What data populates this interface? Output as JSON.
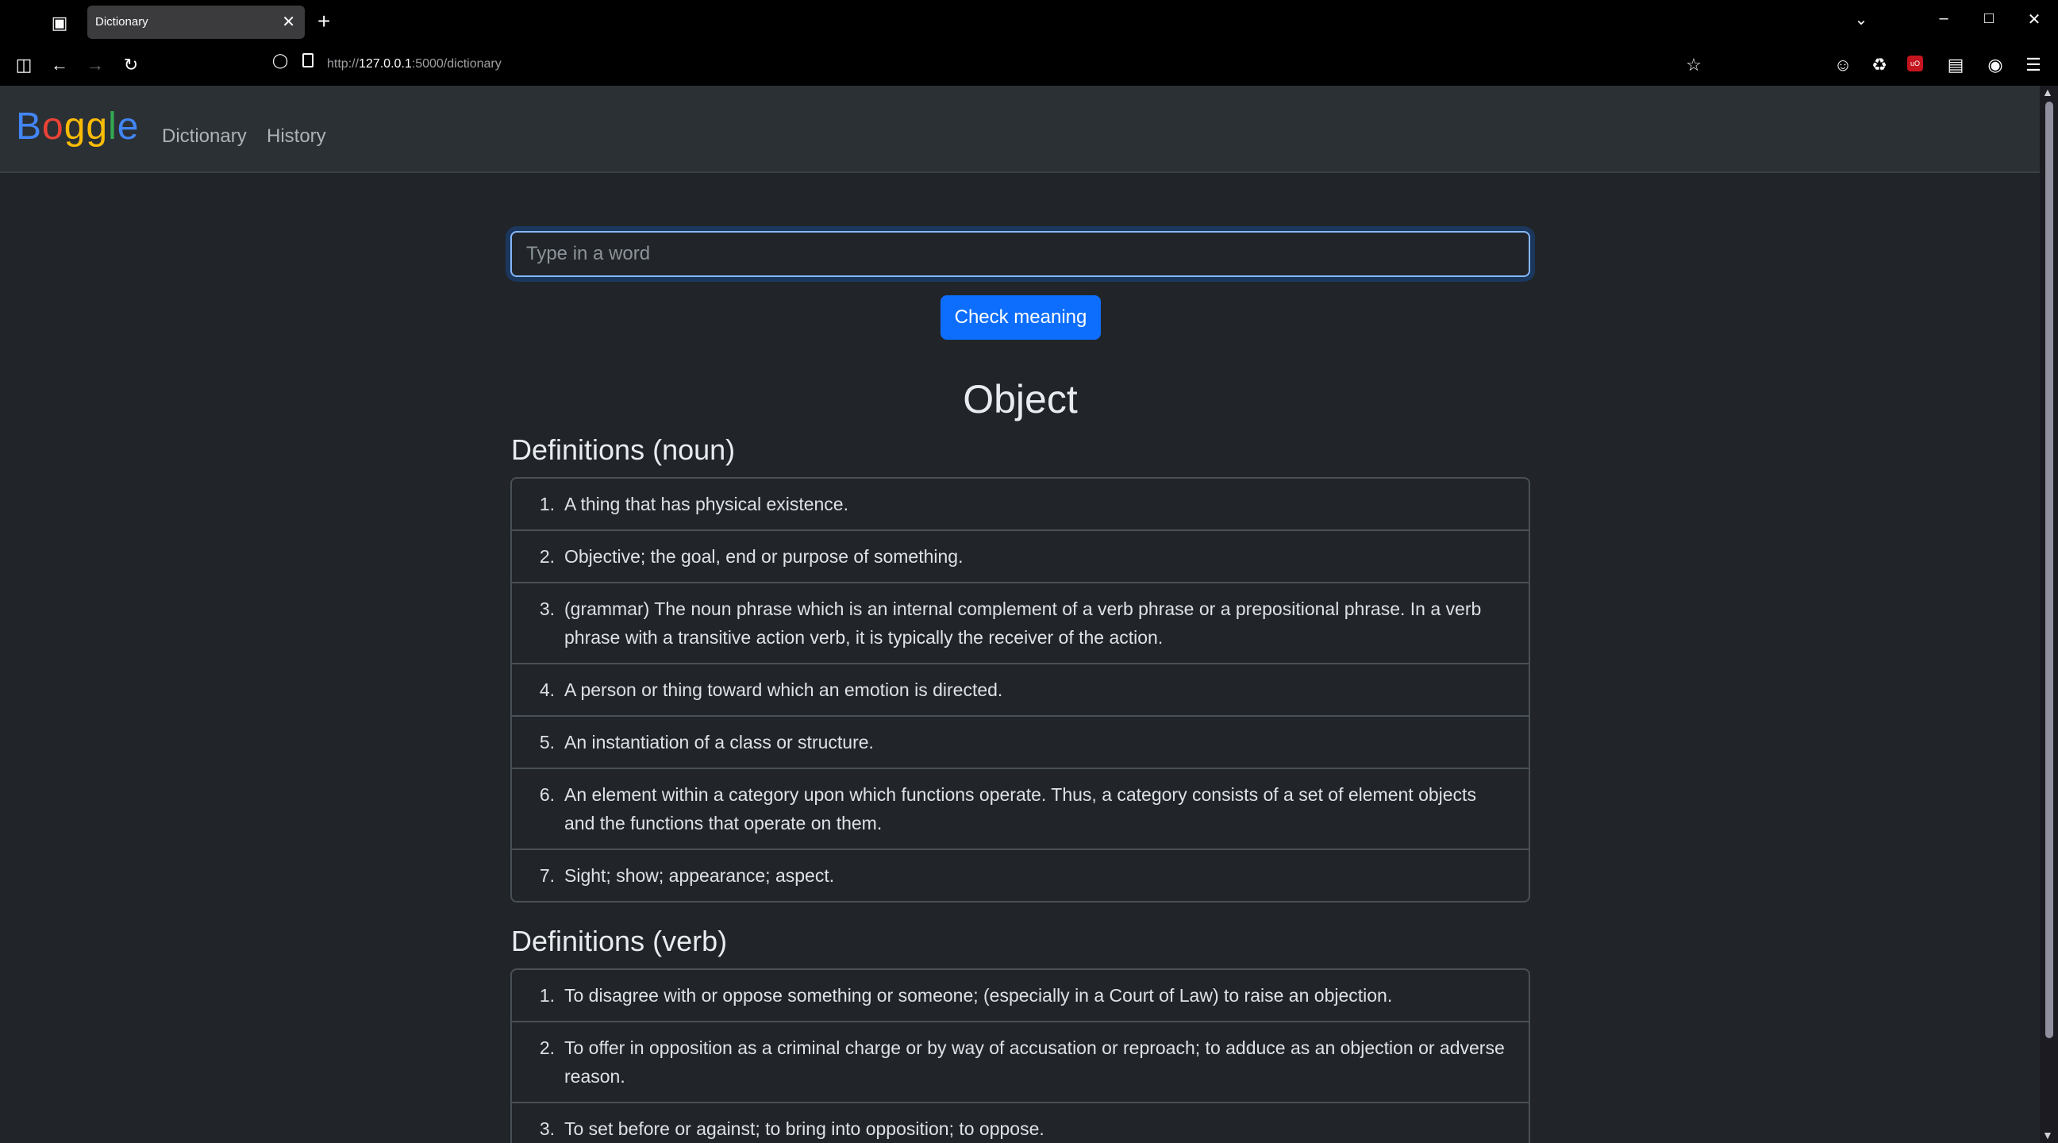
{
  "browser": {
    "tab_title": "Dictionary",
    "url_prefix": "http://",
    "url_host": "127.0.0.1",
    "url_rest": ":5000/dictionary"
  },
  "site": {
    "brand_letters": [
      "B",
      "o",
      "g",
      "g",
      "l",
      "e"
    ],
    "brand_colors": [
      "#4285f4",
      "#ea4335",
      "#fbbc05",
      "#fbbc05",
      "#34a853",
      "#4285f4"
    ],
    "nav": {
      "dictionary": "Dictionary",
      "history": "History"
    }
  },
  "search": {
    "placeholder": "Type in a word",
    "value": "",
    "button_label": "Check meaning"
  },
  "result": {
    "word": "Object",
    "noun_heading": "Definitions (noun)",
    "noun": [
      "A thing that has physical existence.",
      "Objective; the goal, end or purpose of something.",
      "(grammar) The noun phrase which is an internal complement of a verb phrase or a prepositional phrase. In a verb phrase with a transitive action verb, it is typically the receiver of the action.",
      "A person or thing toward which an emotion is directed.",
      "An instantiation of a class or structure.",
      "An element within a category upon which functions operate. Thus, a category consists of a set of element objects and the functions that operate on them.",
      "Sight; show; appearance; aspect."
    ],
    "verb_heading": "Definitions (verb)",
    "verb": [
      "To disagree with or oppose something or someone; (especially in a Court of Law) to raise an objection.",
      "To offer in opposition as a criminal charge or by way of accusation or reproach; to adduce as an objection or adverse reason.",
      "To set before or against; to bring into opposition; to oppose."
    ]
  },
  "colors": {
    "background": "#212529",
    "navbar": "#2b3035",
    "primary_button": "#0d6efd"
  }
}
